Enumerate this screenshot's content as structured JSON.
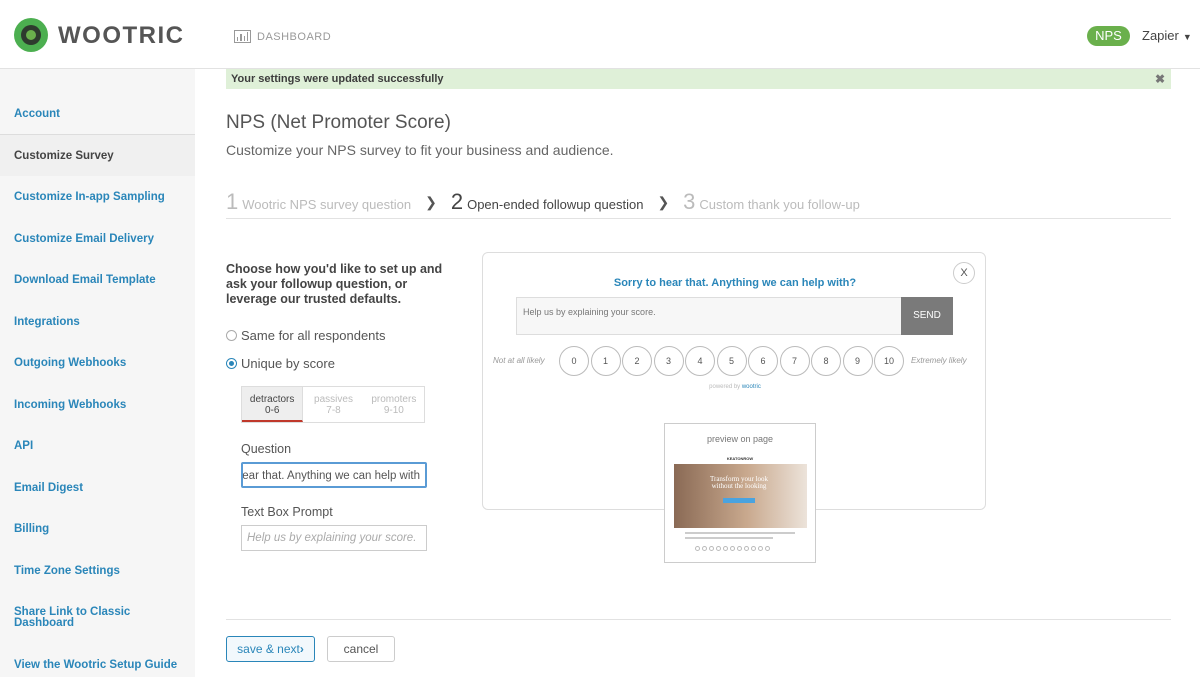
{
  "header": {
    "brand": "WOOTRIC",
    "dashboard_label": "DASHBOARD",
    "product_badge": "NPS",
    "account_name": "Zapier"
  },
  "sidebar": {
    "items": [
      {
        "label": "Account",
        "active": false
      },
      {
        "label": "Customize Survey",
        "active": true
      },
      {
        "label": "Customize In-app Sampling",
        "active": false
      },
      {
        "label": "Customize Email Delivery",
        "active": false
      },
      {
        "label": "Download Email Template",
        "active": false
      },
      {
        "label": "Integrations",
        "active": false
      },
      {
        "label": "Outgoing Webhooks",
        "active": false
      },
      {
        "label": "Incoming Webhooks",
        "active": false
      },
      {
        "label": "API",
        "active": false
      },
      {
        "label": "Email Digest",
        "active": false
      },
      {
        "label": "Billing",
        "active": false
      },
      {
        "label": "Time Zone Settings",
        "active": false
      },
      {
        "label": "Share Link to Classic Dashboard",
        "active": false
      },
      {
        "label": "View the Wootric Setup Guide",
        "active": false
      }
    ]
  },
  "alert": {
    "message": "Your settings were updated successfully",
    "close_glyph": "✖"
  },
  "page": {
    "title": "NPS (Net Promoter Score)",
    "subtitle": "Customize your NPS survey to fit your business and audience."
  },
  "steps": [
    {
      "num": "1",
      "label": "Wootric NPS survey question",
      "current": false
    },
    {
      "num": "2",
      "label": "Open-ended followup question",
      "current": true
    },
    {
      "num": "3",
      "label": "Custom thank you follow-up",
      "current": false
    }
  ],
  "form": {
    "intro": "Choose how you'd like to set up and ask your followup question, or leverage our trusted defaults.",
    "radio_same": "Same for all respondents",
    "radio_unique": "Unique by score",
    "selected_option": "Unique by score",
    "segments": [
      {
        "label": "detractors",
        "range": "0-6",
        "active": true
      },
      {
        "label": "passives",
        "range": "7-8",
        "active": false
      },
      {
        "label": "promoters",
        "range": "9-10",
        "active": false
      }
    ],
    "question_label": "Question",
    "question_value": "Sorry to hear that. Anything we can help with?",
    "prompt_label": "Text Box Prompt",
    "prompt_placeholder": "Help us by explaining your score."
  },
  "preview": {
    "close_label": "X",
    "question": "Sorry to hear that. Anything we can help with?",
    "input_placeholder": "Help us by explaining your score.",
    "send_label": "SEND",
    "low_label": "Not at all likely",
    "high_label": "Extremely likely",
    "scores": [
      "0",
      "1",
      "2",
      "3",
      "4",
      "5",
      "6",
      "7",
      "8",
      "9",
      "10"
    ],
    "powered_prefix": "powered by",
    "powered_brand": "wootric",
    "thumbnail_title": "preview on page",
    "thumbnail_brand": "KEATONROW",
    "thumbnail_headline": "Transform your look without the looking"
  },
  "actions": {
    "save_label": "save & next",
    "save_glyph": "›",
    "cancel_label": "cancel"
  },
  "colors": {
    "brand_green": "#6ab04c",
    "link_blue": "#2a86b9",
    "alert_bg": "#dff0d8",
    "active_segment_underline": "#c0392b"
  }
}
